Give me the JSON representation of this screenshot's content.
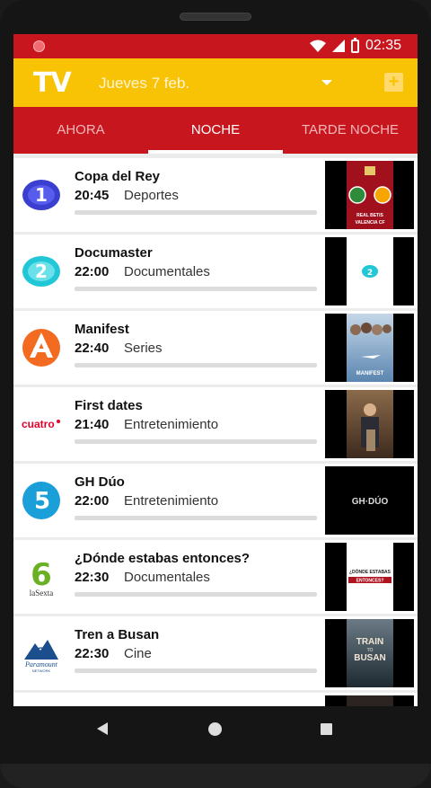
{
  "status": {
    "time": "02:35"
  },
  "appbar": {
    "logo": "TV",
    "date": "Jueves 7 feb.",
    "add_label": "+"
  },
  "tabs": [
    {
      "label": "AHORA",
      "active": false
    },
    {
      "label": "NOCHE",
      "active": true
    },
    {
      "label": "TARDE NOCHE",
      "active": false
    }
  ],
  "programs": [
    {
      "channel": "La 1",
      "channel_icon": "la1-logo-icon",
      "title": "Copa del Rey",
      "time": "20:45",
      "genre": "Deportes",
      "thumb_text": "REAL BETIS VALENCIA CF",
      "thumb_color": "#a0111d"
    },
    {
      "channel": "La 2",
      "channel_icon": "la2-logo-icon",
      "title": "Documaster",
      "time": "22:00",
      "genre": "Documentales",
      "thumb_text": "",
      "thumb_color": "#ffffff"
    },
    {
      "channel": "Antena 3",
      "channel_icon": "antena3-logo-icon",
      "title": "Manifest",
      "time": "22:40",
      "genre": "Series",
      "thumb_text": "MANIFEST",
      "thumb_color": "#6d93b7"
    },
    {
      "channel": "cuatro",
      "channel_icon": "cuatro-logo-icon",
      "title": "First dates",
      "time": "21:40",
      "genre": "Entretenimiento",
      "thumb_text": "",
      "thumb_color": "#6b4e3a"
    },
    {
      "channel": "Telecinco",
      "channel_icon": "telecinco-logo-icon",
      "title": "GH Dúo",
      "time": "22:00",
      "genre": "Entretenimiento",
      "thumb_text": "GH DÚO",
      "thumb_color": "#000000"
    },
    {
      "channel": "laSexta",
      "channel_icon": "lasexta-logo-icon",
      "title": "¿Dónde estabas entonces?",
      "time": "22:30",
      "genre": "Documentales",
      "thumb_text": "¿DÓNDE ESTABAS ENTONCES?",
      "thumb_color": "#ffffff"
    },
    {
      "channel": "Paramount Network",
      "channel_icon": "paramount-logo-icon",
      "title": "Tren a Busan",
      "time": "22:30",
      "genre": "Cine",
      "thumb_text": "TRAIN TO BUSAN",
      "thumb_color": "#3b4a55"
    }
  ],
  "colors": {
    "primary_red": "#c8161e",
    "accent_yellow": "#f8c205"
  }
}
